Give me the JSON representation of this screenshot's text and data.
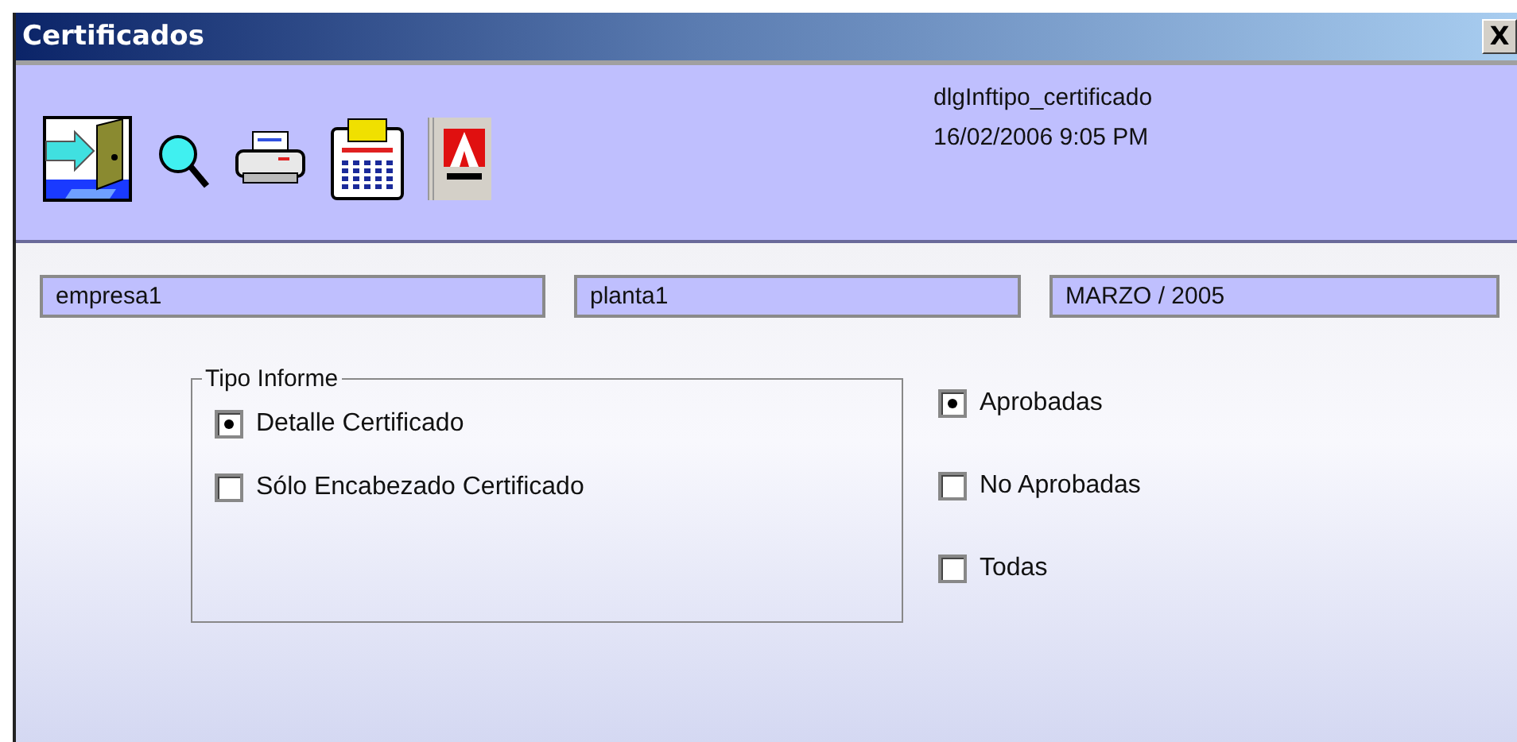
{
  "window": {
    "title": "Certificados",
    "close_label": "X"
  },
  "toolbar": {
    "icons": [
      {
        "kind": "exit"
      },
      {
        "kind": "search"
      },
      {
        "kind": "print"
      },
      {
        "kind": "calculator"
      },
      {
        "kind": "pdf",
        "pressed": true
      }
    ],
    "form_name": "dlgInftipo_certificado",
    "timestamp": "16/02/2006 9:05 PM"
  },
  "fields": [
    {
      "value": "empresa1"
    },
    {
      "value": "planta1"
    },
    {
      "value": "MARZO / 2005"
    }
  ],
  "report_type": {
    "legend": "Tipo Informe",
    "options": [
      {
        "label": "Detalle Certificado",
        "selected": true
      },
      {
        "label": "Sólo Encabezado Certificado",
        "selected": false
      }
    ]
  },
  "status_filter": [
    {
      "label": "Aprobadas",
      "selected": true
    },
    {
      "label": "No Aprobadas",
      "selected": false
    },
    {
      "label": "Todas",
      "selected": false
    }
  ]
}
